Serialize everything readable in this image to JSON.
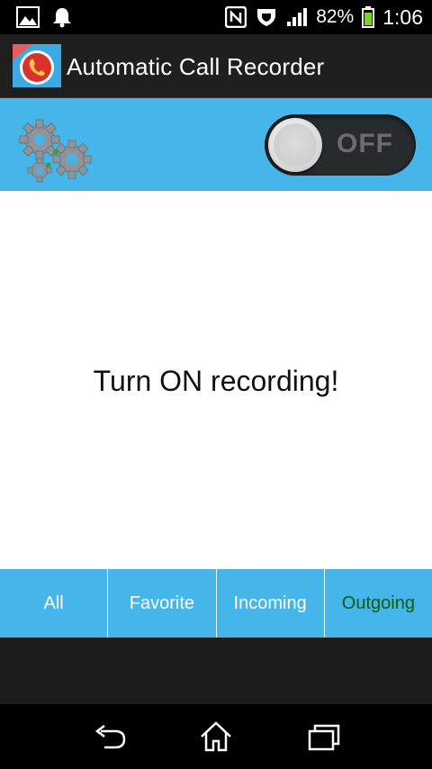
{
  "status_bar": {
    "icons": [
      "image-notification-icon",
      "bell-icon",
      "nfc-icon",
      "shield-icon",
      "signal-icon",
      "battery-icon"
    ],
    "battery_percent": "82%",
    "time": "1:06"
  },
  "app": {
    "title": "Automatic Call Recorder",
    "icon": "call-recorder-app-icon"
  },
  "controls": {
    "settings_icon": "gears-icon",
    "toggle_state": "OFF"
  },
  "main": {
    "message": "Turn ON recording!"
  },
  "tabs": [
    {
      "label": "All",
      "active": false
    },
    {
      "label": "Favorite",
      "active": false
    },
    {
      "label": "Incoming",
      "active": false
    },
    {
      "label": "Outgoing",
      "active": true
    }
  ],
  "nav": {
    "icons": [
      "back-icon",
      "home-icon",
      "recent-apps-icon"
    ]
  },
  "colors": {
    "accent": "#45b5ea",
    "active_tab_text": "#0b5d0b",
    "action_bar": "#1f1f1f"
  }
}
